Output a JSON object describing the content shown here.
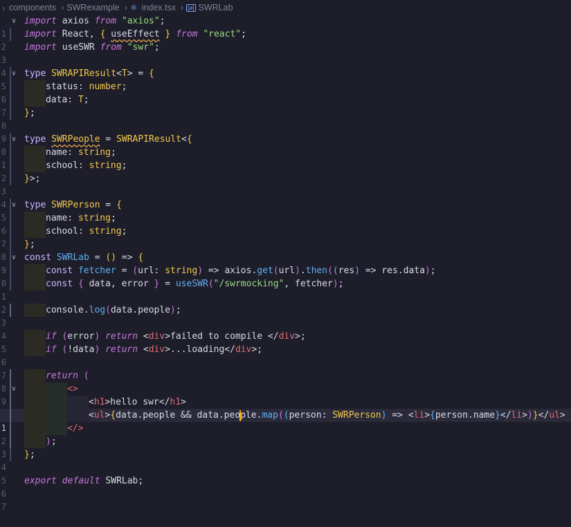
{
  "breadcrumb": {
    "items": [
      "components",
      "SWRexample",
      "index.tsx",
      "SWRLab"
    ]
  },
  "editor": {
    "line_numbers": [
      "1",
      "2",
      "3",
      "4",
      "5",
      "6",
      "7",
      "8",
      "9",
      "0",
      "1",
      "2",
      "3",
      "4",
      "5",
      "6",
      "7",
      "8",
      "9",
      "0",
      "1",
      "2",
      "3",
      "4",
      "5",
      "6",
      "7",
      "8",
      "9",
      "0",
      "1",
      "2",
      "3",
      "4",
      "5",
      "6",
      "7"
    ],
    "active_line_index": 30,
    "code": {
      "l1": [
        "import",
        " axios ",
        "from",
        " ",
        "\"axios\"",
        ";"
      ],
      "l2": [
        "import",
        " React, ",
        "{",
        " ",
        "useEffect",
        " ",
        "}",
        " ",
        "from",
        " ",
        "\"react\"",
        ";"
      ],
      "l3": [
        "import",
        " useSWR ",
        "from",
        " ",
        "\"swr\"",
        ";"
      ],
      "l5": [
        "type",
        " ",
        "SWRAPIResult",
        "<",
        "T",
        "> = ",
        "{"
      ],
      "l6": [
        "status: ",
        "number",
        ";"
      ],
      "l7": [
        "data: ",
        "T",
        ";"
      ],
      "l8": [
        "}",
        ";"
      ],
      "l10": [
        "type",
        " ",
        "SWRPeople",
        " = ",
        "SWRAPIResult",
        "<",
        "{"
      ],
      "l11": [
        "name: ",
        "string",
        ";"
      ],
      "l12": [
        "school: ",
        "string",
        ";"
      ],
      "l13": [
        "}",
        ">;"
      ],
      "l15": [
        "type",
        " ",
        "SWRPerson",
        " = ",
        "{"
      ],
      "l16": [
        "name: ",
        "string",
        ";"
      ],
      "l17": [
        "school: ",
        "string",
        ";"
      ],
      "l18": [
        "}",
        ";"
      ],
      "l19": [
        "const",
        " ",
        "SWRLab",
        " = ",
        "()",
        " => ",
        "{"
      ],
      "l20": [
        "const",
        " ",
        "fetcher",
        " = ",
        "(",
        "url: ",
        "string",
        ")",
        " => axios.",
        "get",
        "(",
        "url",
        ")",
        ".",
        "then",
        "(",
        "(",
        "res",
        ")",
        " => res.data",
        ")",
        ";"
      ],
      "l21": [
        "const",
        " ",
        "{",
        " data, error ",
        "}",
        " = ",
        "useSWR",
        "(",
        "\"/swrmocking\"",
        ", fetcher",
        ")",
        ";"
      ],
      "l23": [
        "console.",
        "log",
        "(",
        "data.people",
        ")",
        ";"
      ],
      "l25": [
        "if",
        " ",
        "(",
        "error",
        ")",
        " ",
        "return",
        " <",
        "div",
        ">failed to compile </",
        "div",
        ">;"
      ],
      "l26": [
        "if",
        " ",
        "(",
        "!data",
        ")",
        " ",
        "return",
        " <",
        "div",
        ">...loading</",
        "div",
        ">;"
      ],
      "l28": [
        "return",
        " ",
        "("
      ],
      "l29": [
        "<>"
      ],
      "l30": [
        "<",
        "h1",
        ">hello swr</",
        "h1",
        ">"
      ],
      "l31": [
        "<",
        "ul",
        ">",
        "{",
        "data.people && data.peo",
        "ple.",
        "map",
        "(",
        "(",
        "person: ",
        "SWRPerson",
        ")",
        " => <",
        "li",
        ">",
        "{",
        "person.name",
        "}",
        "</",
        "li",
        ">",
        ")",
        "}",
        "</",
        "ul",
        ">"
      ],
      "l32": [
        "</>"
      ],
      "l33": [
        ")",
        ";"
      ],
      "l34": [
        "}",
        ";"
      ],
      "l36": [
        "export",
        " ",
        "default",
        " SWRLab;"
      ]
    }
  },
  "colors": {
    "background": "#1e1e2a",
    "keyword": "#c678dd",
    "string": "#98d982",
    "type": "#f2c94c",
    "function": "#61afef",
    "tag": "#e06c75",
    "cursor": "#ffb000"
  }
}
